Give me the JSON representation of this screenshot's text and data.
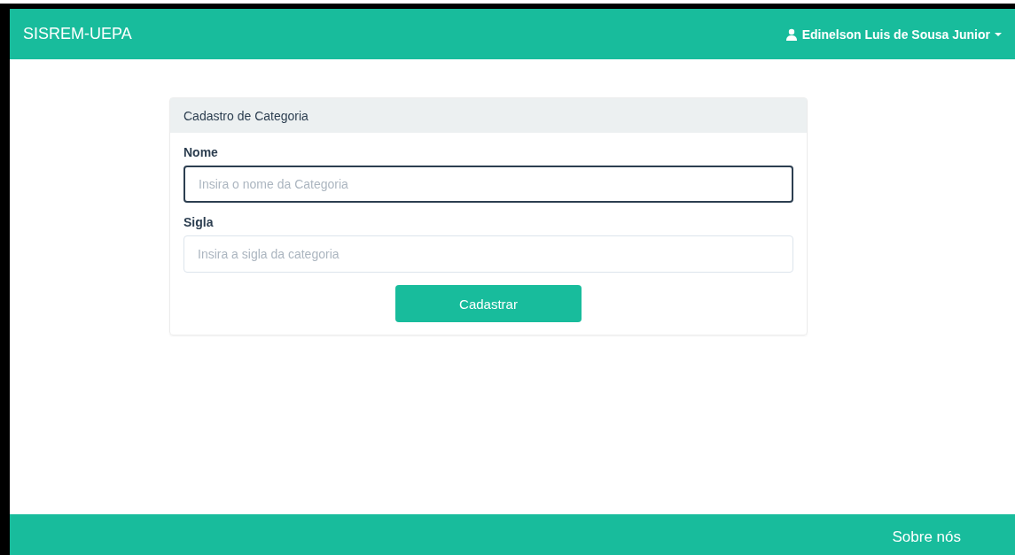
{
  "navbar": {
    "brand": "SISREM-UEPA",
    "user": "Edinelson Luis de Sousa Junior"
  },
  "form": {
    "title": "Cadastro de Categoria",
    "fields": [
      {
        "label": "Nome",
        "placeholder": "Insira o nome da Categoria",
        "focused": true
      },
      {
        "label": "Sigla",
        "placeholder": "Insira a sigla da categoria",
        "focused": false
      }
    ],
    "submit": "Cadastrar"
  },
  "footer": {
    "link": "Sobre nós"
  }
}
